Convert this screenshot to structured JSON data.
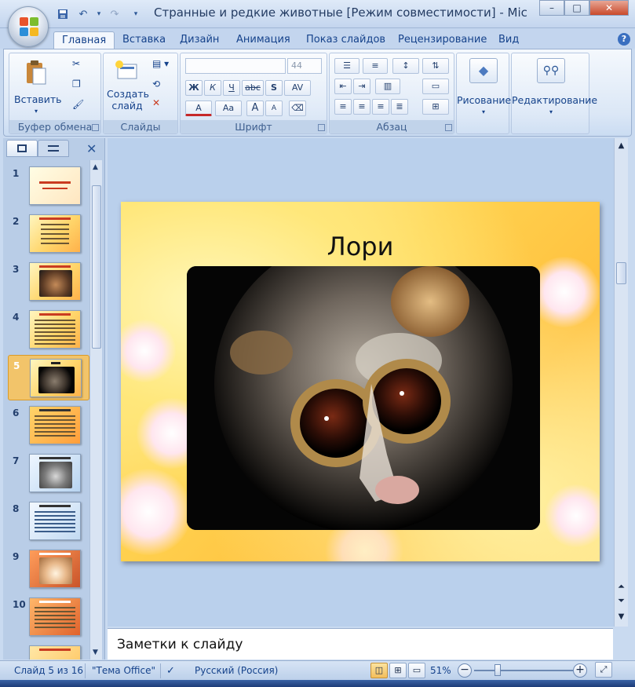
{
  "window": {
    "title": "Странные и редкие животные [Режим совместимости] - Microsof...",
    "controls": {
      "minimize": "–",
      "maximize": "□",
      "close": "✕"
    }
  },
  "qat": {
    "save": "💾",
    "undo": "↶",
    "redo": "↷",
    "more": "▾"
  },
  "tabs": [
    {
      "label": "Главная",
      "active": true
    },
    {
      "label": "Вставка"
    },
    {
      "label": "Дизайн"
    },
    {
      "label": "Анимация"
    },
    {
      "label": "Показ слайдов"
    },
    {
      "label": "Рецензирование"
    },
    {
      "label": "Вид"
    }
  ],
  "help": "?",
  "ribbon": {
    "clipboard": {
      "label": "Буфер обмена",
      "paste": "Вставить"
    },
    "slides": {
      "label": "Слайды",
      "new_slide_1": "Создать",
      "new_slide_2": "слайд"
    },
    "font": {
      "label": "Шрифт",
      "font_size": "44",
      "bold": "Ж",
      "italic": "К",
      "underline": "Ч",
      "strike": "abc",
      "shadow": "S",
      "spacing": "AV",
      "color": "A",
      "case": "Aa",
      "grow": "A",
      "shrink": "A"
    },
    "paragraph": {
      "label": "Абзац"
    },
    "drawing": {
      "label": "Рисование"
    },
    "editing": {
      "label": "Редактирование"
    }
  },
  "slides_panel": {
    "close": "✕",
    "thumbs": [
      {
        "num": "1",
        "selected": false
      },
      {
        "num": "2",
        "selected": false
      },
      {
        "num": "3",
        "selected": false
      },
      {
        "num": "4",
        "selected": false
      },
      {
        "num": "5",
        "selected": true
      },
      {
        "num": "6",
        "selected": false
      },
      {
        "num": "7",
        "selected": false
      },
      {
        "num": "8",
        "selected": false
      },
      {
        "num": "9",
        "selected": false
      },
      {
        "num": "10",
        "selected": false
      }
    ]
  },
  "slide": {
    "title": "Лори"
  },
  "notes": {
    "placeholder": "Заметки к слайду"
  },
  "status": {
    "slide_counter": "Слайд 5 из 16",
    "theme": "\"Тема Office\"",
    "language": "Русский (Россия)",
    "zoom": "51%",
    "zoom_level_percent": 51
  },
  "colors": {
    "accent": "#15428b",
    "selected_thumb": "#f2c46a",
    "ribbon_bg": "#dbe7f6"
  }
}
